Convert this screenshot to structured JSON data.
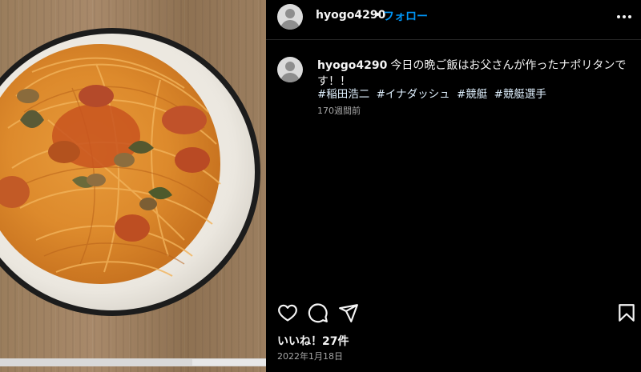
{
  "post": {
    "username": "hyogo4290",
    "separator": "•",
    "follow_label": "フォロー",
    "caption_username": "hyogo4290",
    "caption_text": "今日の晩ご飯はお父さんが作ったナポリタンです！！",
    "hashtags": [
      "#稲田浩二",
      "#イナダッシュ",
      "#競艇",
      "#競艇選手"
    ],
    "time_ago": "170週間前",
    "likes_label": "いいね！27件",
    "date": "2022年1月18日"
  },
  "icons": {
    "more": "more-options-icon",
    "like": "heart-icon",
    "comment": "comment-icon",
    "share": "share-icon",
    "save": "bookmark-icon"
  },
  "colors": {
    "follow": "#0095f6",
    "hashtag": "#e0f1ff",
    "background": "#000000",
    "muted": "#a8a8a8"
  }
}
